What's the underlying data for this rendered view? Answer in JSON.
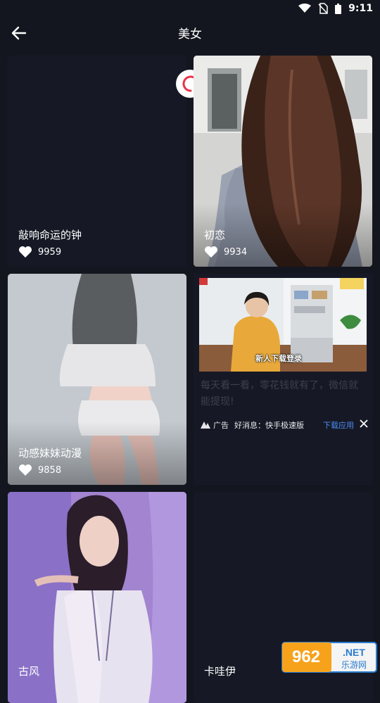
{
  "status_bar": {
    "time": "9:11"
  },
  "header": {
    "title": "美女",
    "back_icon": "arrow-left-icon"
  },
  "cards": [
    {
      "title": "敲响命运的钟",
      "likes": "9959"
    },
    {
      "title": "初恋",
      "likes": "9934"
    },
    {
      "title": "动感妹妹动漫",
      "likes": "9858"
    },
    {
      "title": "古风"
    },
    {
      "title": "卡哇伊"
    }
  ],
  "ad": {
    "image_caption": "新人下载登录",
    "text": "每天看一看，零花钱就有了，微信就能提现!",
    "label": "广告",
    "source": "好消息：快手极速版",
    "download": "下载应用"
  },
  "watermark": {
    "top": "962.NET",
    "bottom": "乐游网"
  },
  "colors": {
    "background": "#14161f",
    "accent": "#4d8cf5",
    "spinner": "#e8344a"
  }
}
